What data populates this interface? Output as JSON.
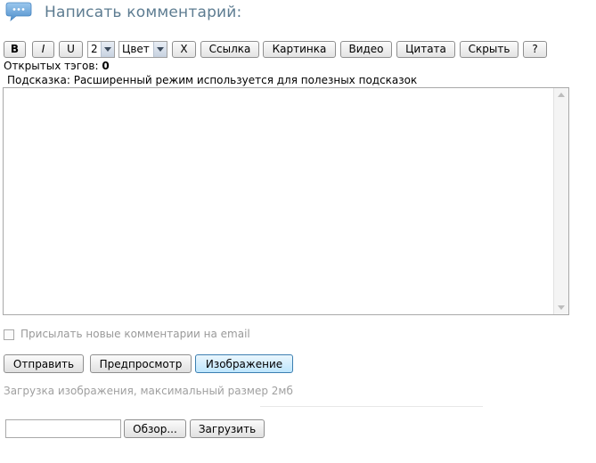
{
  "header": {
    "title": "Написать комментарий:"
  },
  "toolbar": {
    "bold": "B",
    "italic": "I",
    "underline": "U",
    "size_value": "2",
    "color_value": "Цвет",
    "clear": "X",
    "link": "Ссылка",
    "image": "Картинка",
    "video": "Видео",
    "quote": "Цитата",
    "hide": "Скрыть",
    "help": "?"
  },
  "status": {
    "open_tags_label": "Открытых тэгов:",
    "open_tags_count": "0"
  },
  "hint": "Подсказка: Расширенный режим используется для полезных подсказок",
  "comment": {
    "value": ""
  },
  "subscribe": {
    "label": "Присылать новые комментарии на email",
    "checked": false
  },
  "actions": {
    "send": "Отправить",
    "preview": "Предпросмотр",
    "image": "Изображение"
  },
  "upload": {
    "note": "Загрузка изображения, максимальный размер 2мб",
    "file_value": "",
    "browse": "Обзор...",
    "submit": "Загрузить"
  },
  "icons": {
    "header": "speech-bubble-icon"
  },
  "colors": {
    "title": "#5d7c91",
    "icon": "#6aa6d8"
  }
}
